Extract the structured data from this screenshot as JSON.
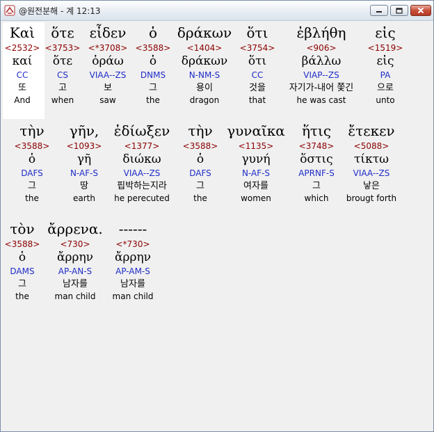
{
  "window": {
    "title": "@원전분해 - 계 12:13"
  },
  "rows": [
    [
      {
        "greek": "Καὶ",
        "strong": "<2532>",
        "lemma": "καί",
        "parse": "CC",
        "korean": "또",
        "english": "And"
      },
      {
        "greek": "ὅτε",
        "strong": "<3753>",
        "lemma": "ὅτε",
        "parse": "CS",
        "korean": "고",
        "english": "when"
      },
      {
        "greek": "εἶδεν",
        "strong": "<*3708>",
        "lemma": "ὁράω",
        "parse": "VIAA--ZS",
        "korean": "보",
        "english": "saw"
      },
      {
        "greek": "ὁ",
        "strong": "<3588>",
        "lemma": "ὁ",
        "parse": "DNMS",
        "korean": "그",
        "english": "the"
      },
      {
        "greek": "δράκων",
        "strong": "<1404>",
        "lemma": "δράκων",
        "parse": "N-NM-S",
        "korean": "용이",
        "english": "dragon"
      },
      {
        "greek": "ὅτι",
        "strong": "<3754>",
        "lemma": "ὅτι",
        "parse": "CC",
        "korean": "것을",
        "english": "that"
      },
      {
        "greek": "ἐβλήθη",
        "strong": "<906>",
        "lemma": "βάλλω",
        "parse": "VIAP--ZS",
        "korean": "자기가-내어 쫓긴",
        "english": "he was cast"
      },
      {
        "greek": "εἰς",
        "strong": "<1519>",
        "lemma": "εἰς",
        "parse": "PA",
        "korean": "으로",
        "english": "unto"
      }
    ],
    [
      {
        "greek": "τὴν",
        "strong": "<3588>",
        "lemma": "ὁ",
        "parse": "DAFS",
        "korean": "그",
        "english": "the"
      },
      {
        "greek": "γῆν,",
        "strong": "<1093>",
        "lemma": "γῆ",
        "parse": "N-AF-S",
        "korean": "땅",
        "english": "earth"
      },
      {
        "greek": "ἐδίωξεν",
        "strong": "<1377>",
        "lemma": "διώκω",
        "parse": "VIAA--ZS",
        "korean": "핍박하는지라",
        "english": "he perecuted"
      },
      {
        "greek": "τὴν",
        "strong": "<3588>",
        "lemma": "ὁ",
        "parse": "DAFS",
        "korean": "그",
        "english": "the"
      },
      {
        "greek": "γυναῖκα",
        "strong": "<1135>",
        "lemma": "γυνή",
        "parse": "N-AF-S",
        "korean": "여자를",
        "english": "women"
      },
      {
        "greek": "ἥτις",
        "strong": "<3748>",
        "lemma": "ὅστις",
        "parse": "APRNF-S",
        "korean": "그",
        "english": "which"
      },
      {
        "greek": "ἔτεκεν",
        "strong": "<5088>",
        "lemma": "τίκτω",
        "parse": "VIAA--ZS",
        "korean": "낳은",
        "english": "brougt forth"
      }
    ],
    [
      {
        "greek": "τὸν",
        "strong": "<3588>",
        "lemma": "ὁ",
        "parse": "DAMS",
        "korean": "그",
        "english": "the"
      },
      {
        "greek": "ἄρρενα.",
        "strong": "<730>",
        "lemma": "ἄρρην",
        "parse": "AP-AN-S",
        "korean": "남자를",
        "english": "man child"
      },
      {
        "greek": "------",
        "strong": "<*730>",
        "lemma": "ἄρρην",
        "parse": "AP-AM-S",
        "korean": "남자를",
        "english": "man child"
      }
    ]
  ]
}
